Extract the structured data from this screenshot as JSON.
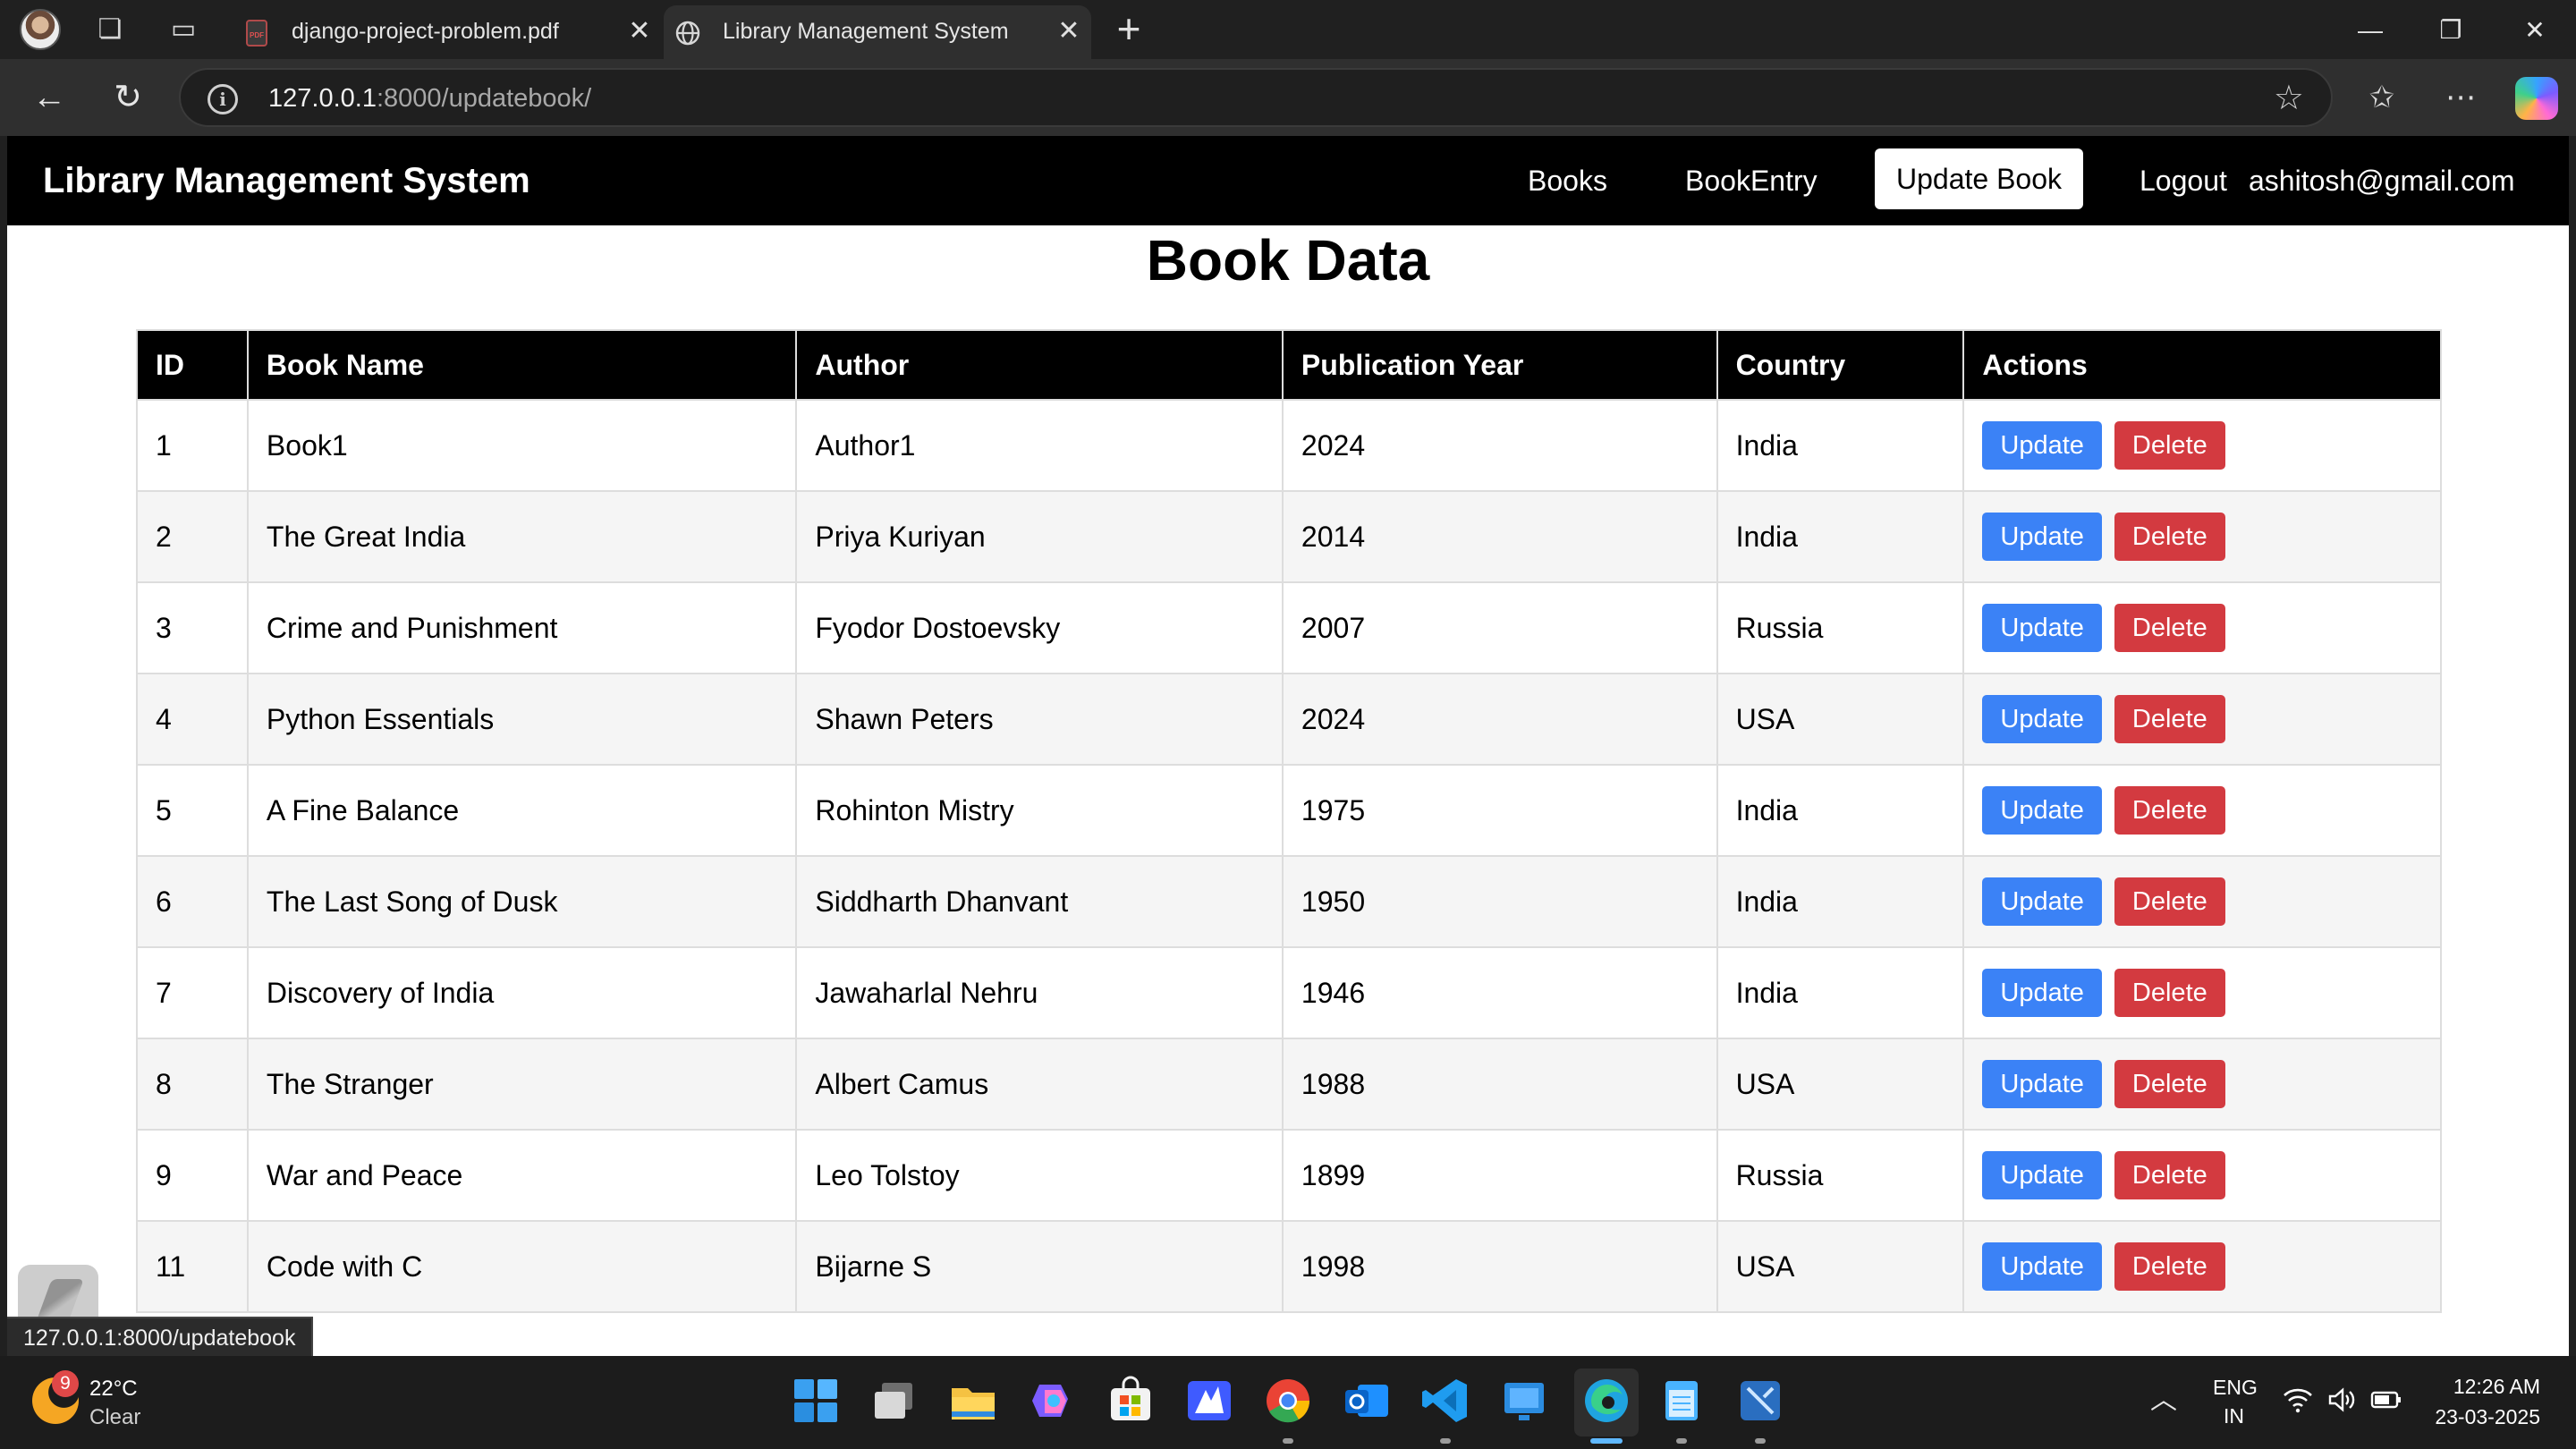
{
  "browser": {
    "tabs": [
      {
        "title": "django-project-problem.pdf",
        "active": false,
        "icon": "pdf-icon"
      },
      {
        "title": "Library Management System",
        "active": true,
        "icon": "globe-icon"
      }
    ],
    "address": {
      "host": "127.0.0.1",
      "path": ":8000/updatebook/"
    },
    "status_url": "127.0.0.1:8000/updatebook"
  },
  "app": {
    "brand": "Library Management System",
    "nav": {
      "books": "Books",
      "book_entry": "BookEntry",
      "update_book": "Update Book",
      "logout": "Logout",
      "user_email": "ashitosh@gmail.com"
    },
    "page_title": "Book Data",
    "table": {
      "headers": [
        "ID",
        "Book Name",
        "Author",
        "Publication Year",
        "Country",
        "Actions"
      ],
      "rows": [
        {
          "id": "1",
          "name": "Book1",
          "author": "Author1",
          "year": "2024",
          "country": "India"
        },
        {
          "id": "2",
          "name": "The Great India",
          "author": "Priya Kuriyan",
          "year": "2014",
          "country": "India"
        },
        {
          "id": "3",
          "name": "Crime and Punishment",
          "author": "Fyodor Dostoevsky",
          "year": "2007",
          "country": "Russia"
        },
        {
          "id": "4",
          "name": "Python Essentials",
          "author": "Shawn Peters",
          "year": "2024",
          "country": "USA"
        },
        {
          "id": "5",
          "name": "A Fine Balance",
          "author": "Rohinton Mistry",
          "year": "1975",
          "country": "India"
        },
        {
          "id": "6",
          "name": "The Last Song of Dusk",
          "author": "Siddharth Dhanvant",
          "year": "1950",
          "country": "India"
        },
        {
          "id": "7",
          "name": "Discovery of India",
          "author": "Jawaharlal Nehru",
          "year": "1946",
          "country": "India"
        },
        {
          "id": "8",
          "name": "The Stranger",
          "author": "Albert Camus",
          "year": "1988",
          "country": "USA"
        },
        {
          "id": "9",
          "name": "War and Peace",
          "author": "Leo Tolstoy",
          "year": "1899",
          "country": "Russia"
        },
        {
          "id": "11",
          "name": "Code with C",
          "author": "Bijarne S",
          "year": "1998",
          "country": "USA"
        }
      ],
      "update_label": "Update",
      "delete_label": "Delete"
    }
  },
  "colors": {
    "update_button": "#3b82f6",
    "delete_button": "#d33a40",
    "navbar": "#000000",
    "header_row": "#000000"
  },
  "taskbar": {
    "weather_badge": "9",
    "temperature": "22°C",
    "condition": "Clear",
    "lang_line1": "ENG",
    "lang_line2": "IN",
    "time": "12:26 AM",
    "date": "23-03-2025",
    "apps": [
      "start-icon",
      "task-view-icon",
      "file-explorer-icon",
      "copilot-icon",
      "store-icon",
      "app-icon",
      "chrome-icon",
      "outlook-icon",
      "vscode-icon",
      "widget-app-icon",
      "edge-icon",
      "notepad-icon",
      "app-icon"
    ]
  }
}
